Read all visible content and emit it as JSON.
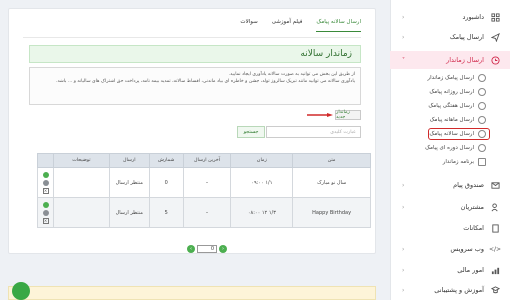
{
  "sidebar": {
    "items": [
      {
        "label": "داشبورد",
        "icon": "dashboard-icon"
      },
      {
        "label": "ارسال پیامک",
        "icon": "send-icon"
      },
      {
        "label": "ارسال زماندار",
        "icon": "clock-icon"
      },
      {
        "label": "صندوق پیام",
        "icon": "mail-icon"
      },
      {
        "label": "مشتریان",
        "icon": "users-icon"
      },
      {
        "label": "امکانات",
        "icon": "features-icon"
      },
      {
        "label": "وب سرویس",
        "icon": "code-icon"
      },
      {
        "label": "امور مالی",
        "icon": "finance-icon"
      },
      {
        "label": "آموزش و پشتیبانی",
        "icon": "support-icon"
      }
    ],
    "subitems": [
      "ارسال پیامک زماندار",
      "ارسال روزانه پیامک",
      "ارسال هفتگی پیامک",
      "ارسال ماهانه پیامک",
      "ارسال سالانه پیامک",
      "ارسال دوره ای پیامک",
      "برنامه زماندار"
    ]
  },
  "tabs": [
    "ارسال سالانه پیامک",
    "فیلم آموزشی",
    "سوالات"
  ],
  "page_title": "زماندار سالانه",
  "notice": [
    "از طریق این بخش می توانید به صورت سالانه یادآوری ایجاد نمایید.",
    "یادآوری سالانه می توانید مانند تبریک سالروز تولد، جشن و خاطره ای بیاد ماندنی، اقساط سالانه، تمدید بیمه نامه، پرداخت حق اشتراک های سالیانه و ... باشد."
  ],
  "new_button": "زماندار جدید",
  "search": {
    "placeholder": "عبارت کلیدی",
    "button": "جستجو"
  },
  "table": {
    "headers": [
      "متن",
      "زمان",
      "آخرین ارسال",
      "شمارش",
      "ارسال",
      "توضیحات"
    ],
    "rows": [
      {
        "text": "سال نو مبارک",
        "time": "۱/۱ ۰۹:۰۰",
        "last": "–",
        "count": "0",
        "status": "منتظر ارسال",
        "desc": ""
      },
      {
        "text": "Happy Birthday",
        "time": "۱/۳ ۱۲ ۰۸:۰۰",
        "last": "–",
        "count": "5",
        "status": "منتظر ارسال",
        "desc": ""
      }
    ]
  },
  "pager": {
    "page": "0"
  },
  "colors": {
    "accent": "#d1274a",
    "green": "#3a8a3a"
  }
}
